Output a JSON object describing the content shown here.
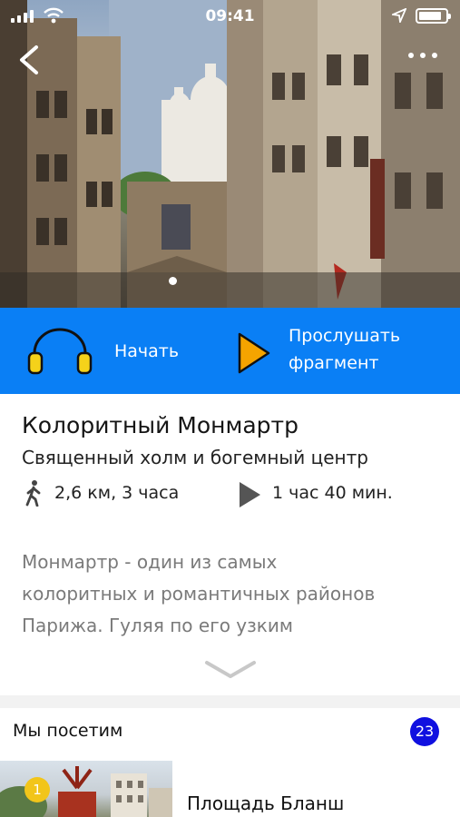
{
  "status_bar": {
    "time": "09:41",
    "battery_level": 0.85
  },
  "hero": {
    "slide_count": 1,
    "active_slide": 1
  },
  "actions": {
    "start_label": "Начать",
    "listen_label_line1": "Прослушать",
    "listen_label_line2": "фрагмент",
    "headphones_color": "#f5d21a",
    "play_color": "#f5a400"
  },
  "tour": {
    "title": "Колоритный Монмартр",
    "subtitle": "Священный холм и богемный центр",
    "distance_time": "2,6 км,  3 часа",
    "audio_duration": "1 час 40 мин.",
    "description_lines": [
      "Монмартр - один из самых",
      "колоритных и романтичных районов",
      "Парижа. Гуляя по его узким"
    ]
  },
  "visit": {
    "heading": "Мы посетим",
    "count": "23",
    "places": [
      {
        "number": "1",
        "name": "Площадь Бланш"
      }
    ]
  },
  "colors": {
    "accent_blue": "#0a7ff5",
    "count_badge": "#1010e0",
    "number_badge": "#f2c51a"
  }
}
